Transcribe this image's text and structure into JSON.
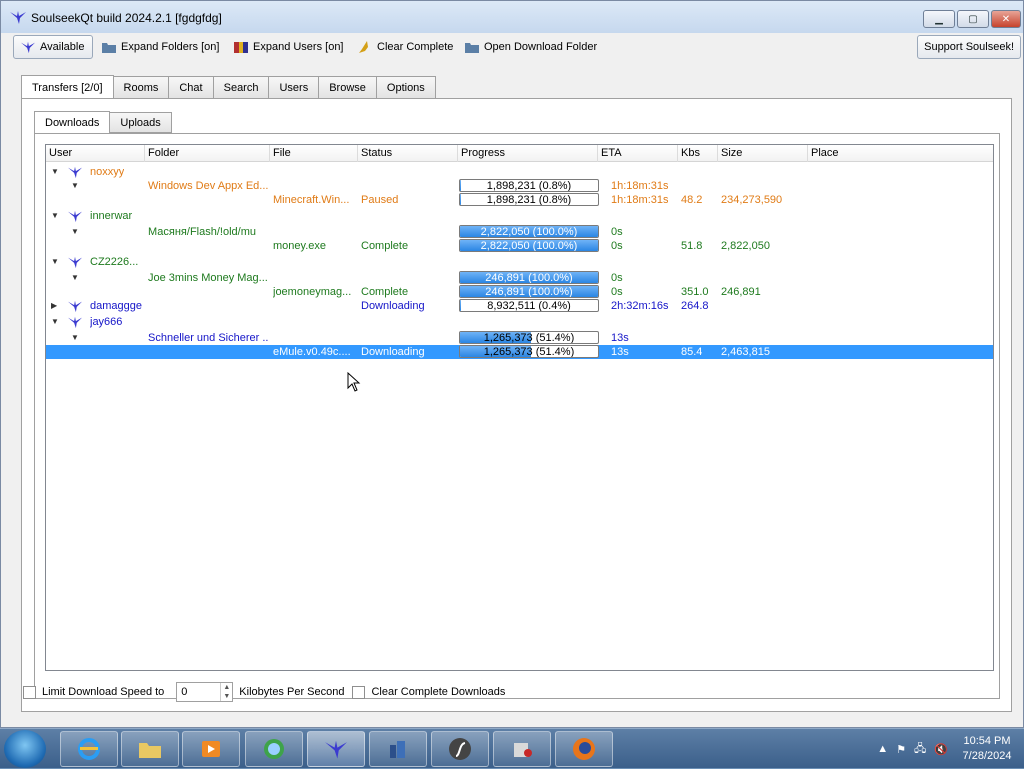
{
  "window": {
    "title": "SoulseekQt build 2024.2.1 [fgdgfdg]"
  },
  "toolbar": {
    "status": "Available",
    "expand_folders": "Expand Folders [on]",
    "expand_users": "Expand Users [on]",
    "clear_complete": "Clear Complete",
    "open_download_folder": "Open Download Folder",
    "support": "Support Soulseek!"
  },
  "tabs": [
    "Transfers [2/0]",
    "Rooms",
    "Chat",
    "Search",
    "Users",
    "Browse",
    "Options"
  ],
  "subtabs": [
    "Downloads",
    "Uploads"
  ],
  "columns": {
    "user": "User",
    "folder": "Folder",
    "file": "File",
    "status": "Status",
    "progress": "Progress",
    "eta": "ETA",
    "kbs": "Kbs",
    "size": "Size",
    "place": "Place"
  },
  "rows": [
    {
      "user": "noxxyy"
    },
    {
      "folder": "Windows Dev Appx Ed...",
      "progress": "1,898,231 (0.8%)",
      "eta": "1h:18m:31s"
    },
    {
      "file": "Minecraft.Win...",
      "status": "Paused",
      "progress": "1,898,231 (0.8%)",
      "eta": "1h:18m:31s",
      "kbs": "48.2",
      "size": "234,273,590"
    },
    {
      "user": "innerwar"
    },
    {
      "folder": "Масяня/Flash/!old/mu",
      "progress": "2,822,050 (100.0%)",
      "eta": "0s"
    },
    {
      "file": "money.exe",
      "status": "Complete",
      "progress": "2,822,050 (100.0%)",
      "eta": "0s",
      "kbs": "51.8",
      "size": "2,822,050"
    },
    {
      "user": "CZ2226..."
    },
    {
      "folder": "Joe 3mins Money Mag...",
      "progress": "246,891 (100.0%)",
      "eta": "0s"
    },
    {
      "file": "joemoneymag...",
      "status": "Complete",
      "progress": "246,891 (100.0%)",
      "eta": "0s",
      "kbs": "351.0",
      "size": "246,891"
    },
    {
      "user": "damaggge",
      "status": "Downloading",
      "progress": "8,932,511 (0.4%)",
      "eta": "2h:32m:16s",
      "kbs": "264.8"
    },
    {
      "user": "jay666"
    },
    {
      "folder": "Schneller und Sicherer ...",
      "progress": "1,265,373 (51.4%)",
      "eta": "13s"
    },
    {
      "file": "eMule.v0.49c....",
      "status": "Downloading",
      "progress": "1,265,373 (51.4%)",
      "eta": "13s",
      "kbs": "85.4",
      "size": "2,463,815"
    }
  ],
  "progress_fractions": [
    0.008,
    0.008,
    1.0,
    1.0,
    1.0,
    1.0,
    0.004,
    0.514,
    0.514
  ],
  "bottom": {
    "limit_label": "Limit Download Speed to",
    "speed_value": "0",
    "unit_label": "Kilobytes Per Second",
    "clear_label": "Clear Complete Downloads"
  },
  "taskbar": {
    "time": "10:54 PM",
    "date": "7/28/2024"
  },
  "colors": {
    "orange": "#e07b16",
    "green": "#1e7a1e",
    "blue": "#1515c8",
    "selection": "#3399ff"
  }
}
